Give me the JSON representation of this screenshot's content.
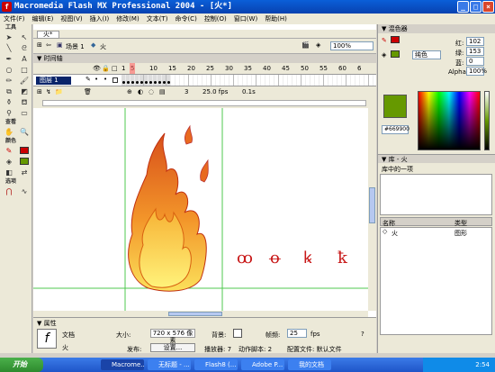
{
  "window": {
    "title": "Macromedia Flash MX Professional 2004 - [火*]"
  },
  "menu": [
    "文件(F)",
    "编辑(E)",
    "视图(V)",
    "插入(I)",
    "修改(M)",
    "文本(T)",
    "命令(C)",
    "控制(O)",
    "窗口(W)",
    "帮助(H)"
  ],
  "tools": {
    "title": "工具",
    "view_label": "查看",
    "colors_label": "颜色",
    "options_label": "选项"
  },
  "document": {
    "tab": "火*",
    "scene_label": "场景 1",
    "symbol_name": "火",
    "zoom": "100%"
  },
  "timeline": {
    "title": "时间轴",
    "layer_name": "图层 1",
    "ruler": [
      "1",
      "5",
      "10",
      "15",
      "20",
      "25",
      "30",
      "35",
      "40",
      "45",
      "50",
      "55",
      "60",
      "6"
    ],
    "current_frame": "3",
    "fps": "25.0 fps",
    "time": "0.1s"
  },
  "stage": {
    "caption_chars": [
      "ꝏ",
      "ꝋ",
      "ꝃ",
      "ꝁ"
    ]
  },
  "properties": {
    "title": "属性",
    "doc_label": "文档",
    "doc_name": "火",
    "size_label": "大小:",
    "size_value": "720 x 576 像素",
    "bg_label": "背景:",
    "fps_label": "帧频:",
    "fps_value": "25",
    "fps_unit": "fps",
    "publish_label": "发布:",
    "settings_button": "设置...",
    "player_label": "播放器: 7",
    "script_label": "动作脚本: 2",
    "profile_label": "配置文件: 默认文件"
  },
  "color_mixer": {
    "title": "混色器",
    "fill_type": "纯色",
    "red_label": "红:",
    "red_value": "102",
    "green_label": "绿:",
    "green_value": "153",
    "blue_label": "蓝:",
    "blue_value": "0",
    "alpha_label": "Alpha:",
    "alpha_value": "100%",
    "hex": "#669900",
    "swatch_color": "#669900"
  },
  "library": {
    "title": "库 - 火",
    "count": "库中的一项",
    "col_name": "名称",
    "col_type": "类型",
    "items": [
      {
        "name": "火",
        "type": "图形"
      }
    ]
  },
  "taskbar": {
    "start": "开始",
    "tasks": [
      "Macrome...",
      "无标题 - ...",
      "Flash8 (...",
      "Adobe P...",
      "我的文档"
    ],
    "clock": "2:54"
  }
}
